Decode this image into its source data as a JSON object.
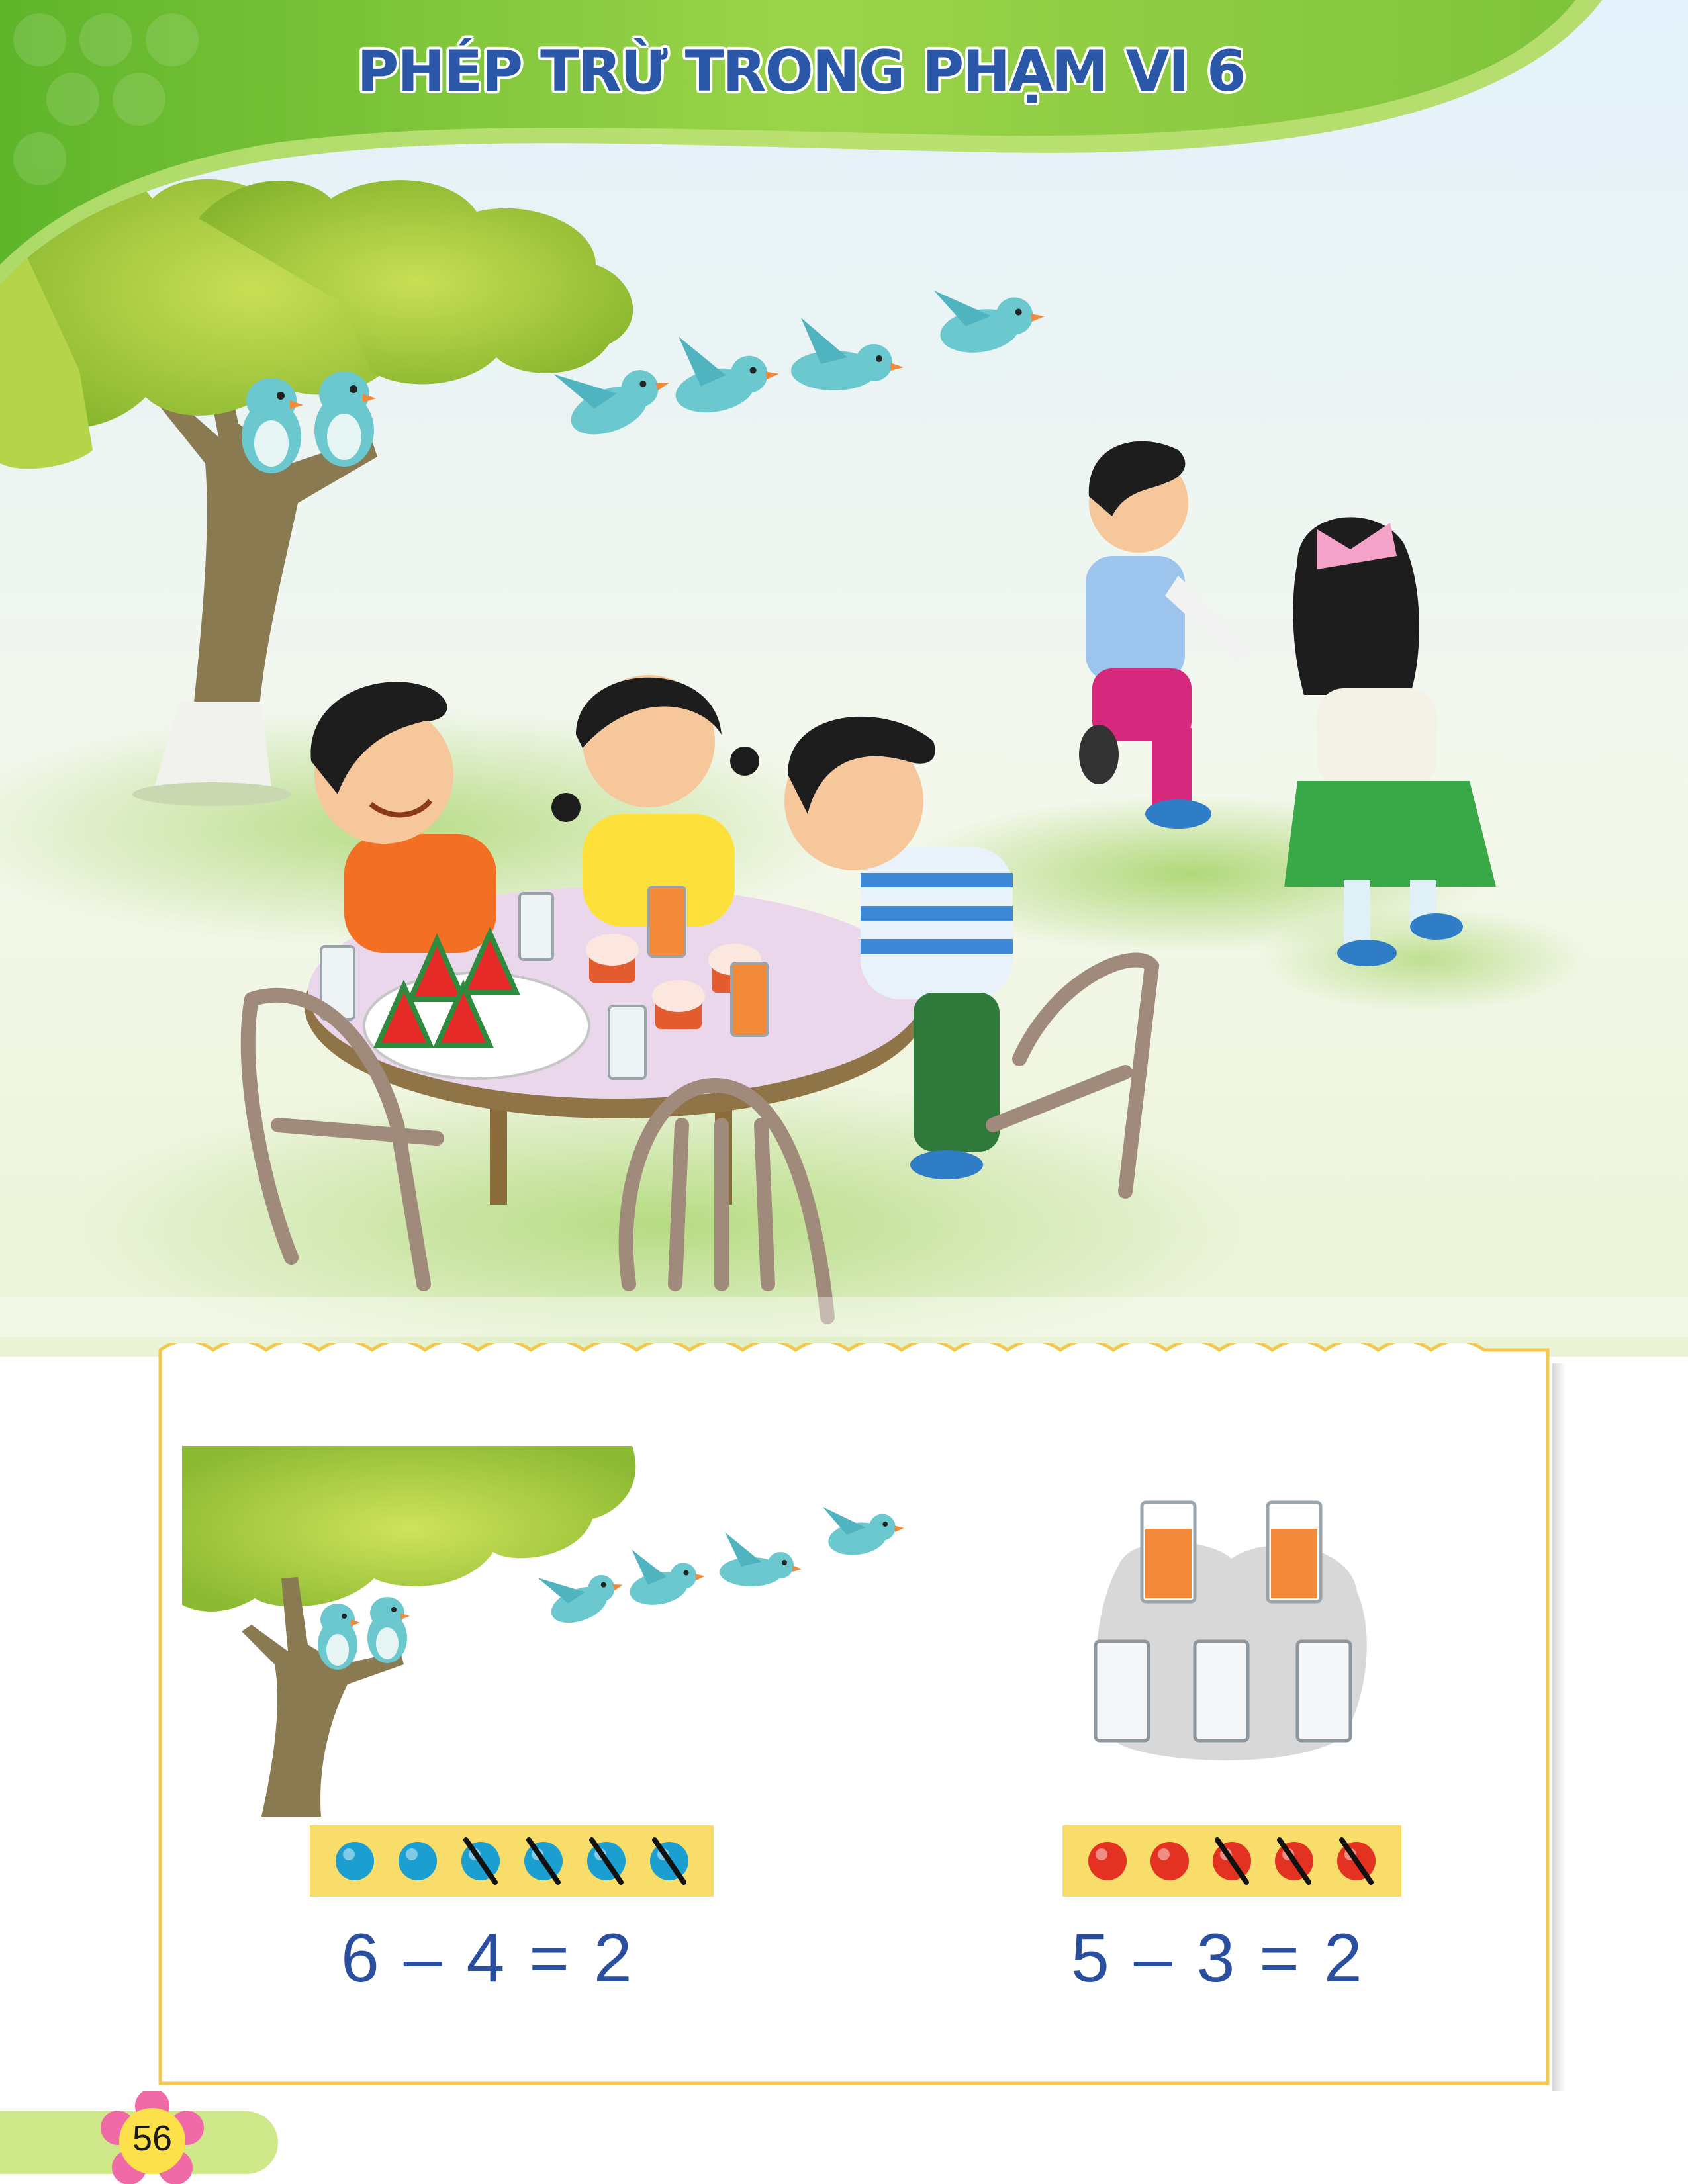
{
  "header": {
    "title": "PHÉP TRỪ TRONG PHẠM VI 6",
    "band_color": "#8ccd3c",
    "title_color": "#2b57a8"
  },
  "scene": {
    "description_icons": [
      "tree-icon",
      "bird-icon",
      "child-icon",
      "table-icon",
      "chair-icon",
      "watermelon-icon",
      "cupcake-icon",
      "glass-icon"
    ]
  },
  "example_left": {
    "counters": {
      "total": 6,
      "crossed": 4,
      "color": "#1a9fd0"
    },
    "equation": "6 – 4 = 2"
  },
  "example_right": {
    "glasses": {
      "full": 2,
      "empty": 3
    },
    "counters": {
      "total": 5,
      "crossed": 3,
      "color": "#e33222"
    },
    "equation": "5 – 3 = 2"
  },
  "footer": {
    "page_number": "56"
  },
  "colors": {
    "frame_border": "#f2c94c",
    "counter_bar": "#f8dd6a",
    "equation_text": "#2b4f9f",
    "page_tab": "#cfe88a",
    "flower": "#f06aa8"
  }
}
